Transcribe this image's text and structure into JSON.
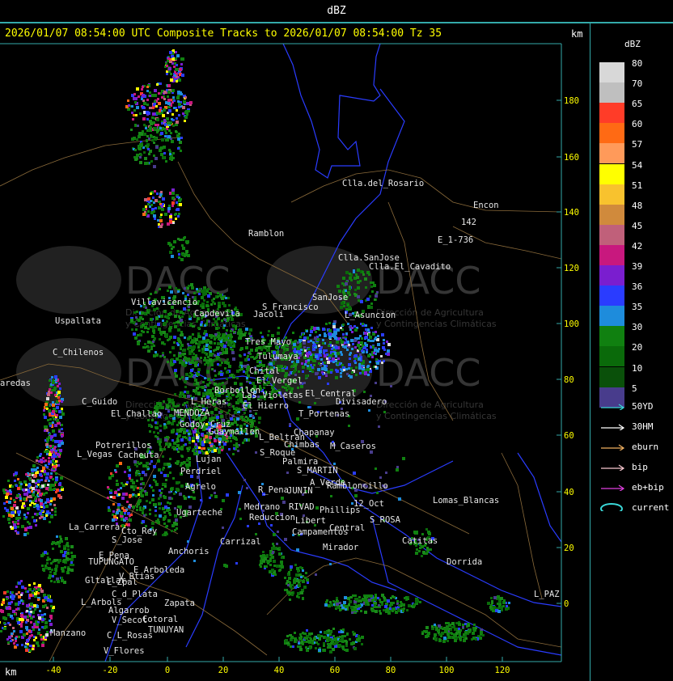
{
  "window_title": "dBZ",
  "header": "2026/01/07 08:54:00 UTC Composite Tracks to 2026/01/07 08:54:00 Tz 35",
  "km_label": "km",
  "x_axis": {
    "ticks": [
      "-40",
      "-20",
      "0",
      "20",
      "40",
      "60",
      "80",
      "100",
      "120"
    ]
  },
  "y_axis": {
    "ticks": [
      "180",
      "160",
      "140",
      "120",
      "100",
      "80",
      "60",
      "40",
      "20",
      "0"
    ]
  },
  "watermark": {
    "logo_text": "DACC",
    "line1": "Dirección de Agricultura",
    "line2": "y Contingencias Climáticas"
  },
  "place_names": [
    "Clla.del_Rosario",
    "Encon",
    "142",
    "E_1-736",
    "Ramblon",
    "Clla.SanJose",
    "Clla.El_Cavadito",
    "Villavicencio",
    "Uspallata",
    "Capdevila",
    "S_Francisco",
    "Jacoli",
    "SanJose",
    "L_Asuncion",
    "C_Chilenos",
    "Tres_Mayo",
    "Tulumaya",
    "Chital",
    "El_Vergel",
    "Borbollon",
    "Las_Violetas",
    "El_Central",
    "Divisadero",
    "C_Guido",
    "El_Challao",
    "L_Heras",
    "El_Hierro",
    "MENDOZA",
    "Godoy_Cruz",
    "Guaymallen",
    "T_Portenas",
    "Potrerillos",
    "L_Vegas",
    "Cacheuta",
    "L_Beltran",
    "Chapanay",
    "Chimbas",
    "M_Caseros",
    "S_Roque",
    "Palmira",
    "Lujan",
    "Perdriel",
    "S_MARTIN",
    "A_Verde",
    "Agrelo",
    "R_Pena",
    "JUNIN",
    "Rambloncillo",
    "Lomas_Blancas",
    "Ugarteche",
    "Medrano",
    "RIVAD",
    "Phillips",
    "12_Oct",
    "Reduccion",
    "Libert",
    "S_ROSA",
    "Campamentos",
    "Central",
    "La_Carrera",
    "Cto_Rey",
    "S_Jose",
    "Carrizal",
    "Catitas",
    "E_Pena",
    "Anchoris",
    "TUPUNGATO",
    "Mirador",
    "Dorrida",
    "V_Btias",
    "E_Arboleda",
    "Gltallar",
    "E_Zpal",
    "L_PAZ",
    "L_Arbols",
    "C_d_Plata",
    "Zapata",
    "Algarrob",
    "V_Secot",
    "Cotoral",
    "TUNUYAN",
    "Manzano",
    "C_L_Rosas",
    "V_Flores",
    "aredas"
  ],
  "legend": {
    "title": "dBZ",
    "levels": [
      {
        "label": "80",
        "color": "#d8d8d8"
      },
      {
        "label": "70",
        "color": "#bfbfbf"
      },
      {
        "label": "65",
        "color": "#ff3c28"
      },
      {
        "label": "60",
        "color": "#ff6a14"
      },
      {
        "label": "57",
        "color": "#ff9a5a"
      },
      {
        "label": "54",
        "color": "#ffff00"
      },
      {
        "label": "51",
        "color": "#f8c22e"
      },
      {
        "label": "48",
        "color": "#d08a3c"
      },
      {
        "label": "45",
        "color": "#c0607a"
      },
      {
        "label": "42",
        "color": "#c8187e"
      },
      {
        "label": "39",
        "color": "#7a1ecf"
      },
      {
        "label": "36",
        "color": "#2a3cff"
      },
      {
        "label": "35",
        "color": "#1e8cdc"
      },
      {
        "label": "30",
        "color": "#108010"
      },
      {
        "label": "20",
        "color": "#0a6a0a"
      },
      {
        "label": "10",
        "color": "#0a500a"
      },
      {
        "label": "5",
        "color": "#483c8c"
      }
    ],
    "tracks": [
      {
        "label": "50YD",
        "color": "#3ad8d8"
      },
      {
        "label": "30HM",
        "color": "#ffffff"
      },
      {
        "label": "eburn",
        "color": "#f0b060"
      },
      {
        "label": "bip",
        "color": "#f8c8d0"
      },
      {
        "label": "eb+bip",
        "color": "#e040e0"
      },
      {
        "label": "current",
        "color": "#3ad8d8"
      }
    ]
  }
}
